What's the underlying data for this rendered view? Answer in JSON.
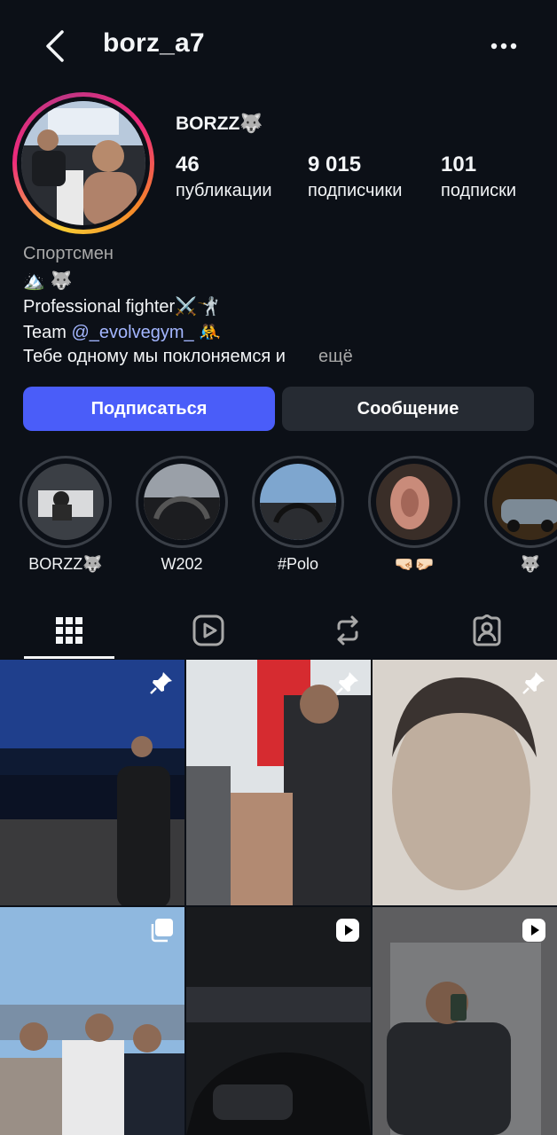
{
  "header": {
    "username": "borz_a7",
    "back_icon": "chevron-left-icon",
    "more_icon": "more-horizontal-icon"
  },
  "profile": {
    "display_name": "BORZZ🐺",
    "stats": [
      {
        "value": "46",
        "label": "публикации"
      },
      {
        "value": "9 015",
        "label": "подписчики"
      },
      {
        "value": "101",
        "label": "подписки"
      }
    ],
    "category": "Спортсмен",
    "bio_line1": "🏔️ 🐺",
    "bio_line2": "Professional fighter⚔️🤺",
    "bio_line3_prefix": "Team ",
    "bio_line3_mention": "@_evolvegym_",
    "bio_line3_suffix": " 🤼",
    "bio_line4": "Тебе одному мы поклоняемся и",
    "bio_more": "ещё"
  },
  "actions": {
    "follow_label": "Подписаться",
    "message_label": "Сообщение"
  },
  "highlights": [
    {
      "label": "BORZZ🐺"
    },
    {
      "label": "W202"
    },
    {
      "label": "#Polo"
    },
    {
      "label": "🤜🏻🤛🏻"
    },
    {
      "label": "🐺"
    }
  ],
  "tabs": [
    {
      "name": "posts",
      "icon": "grid-icon"
    },
    {
      "name": "reels",
      "icon": "reels-icon"
    },
    {
      "name": "reposts",
      "icon": "repost-icon"
    },
    {
      "name": "tagged",
      "icon": "tagged-user-icon"
    }
  ],
  "colors": {
    "background": "#0c1017",
    "follow_button": "#4a5df9",
    "message_button": "#262b33",
    "mention": "#a3b6ff"
  }
}
